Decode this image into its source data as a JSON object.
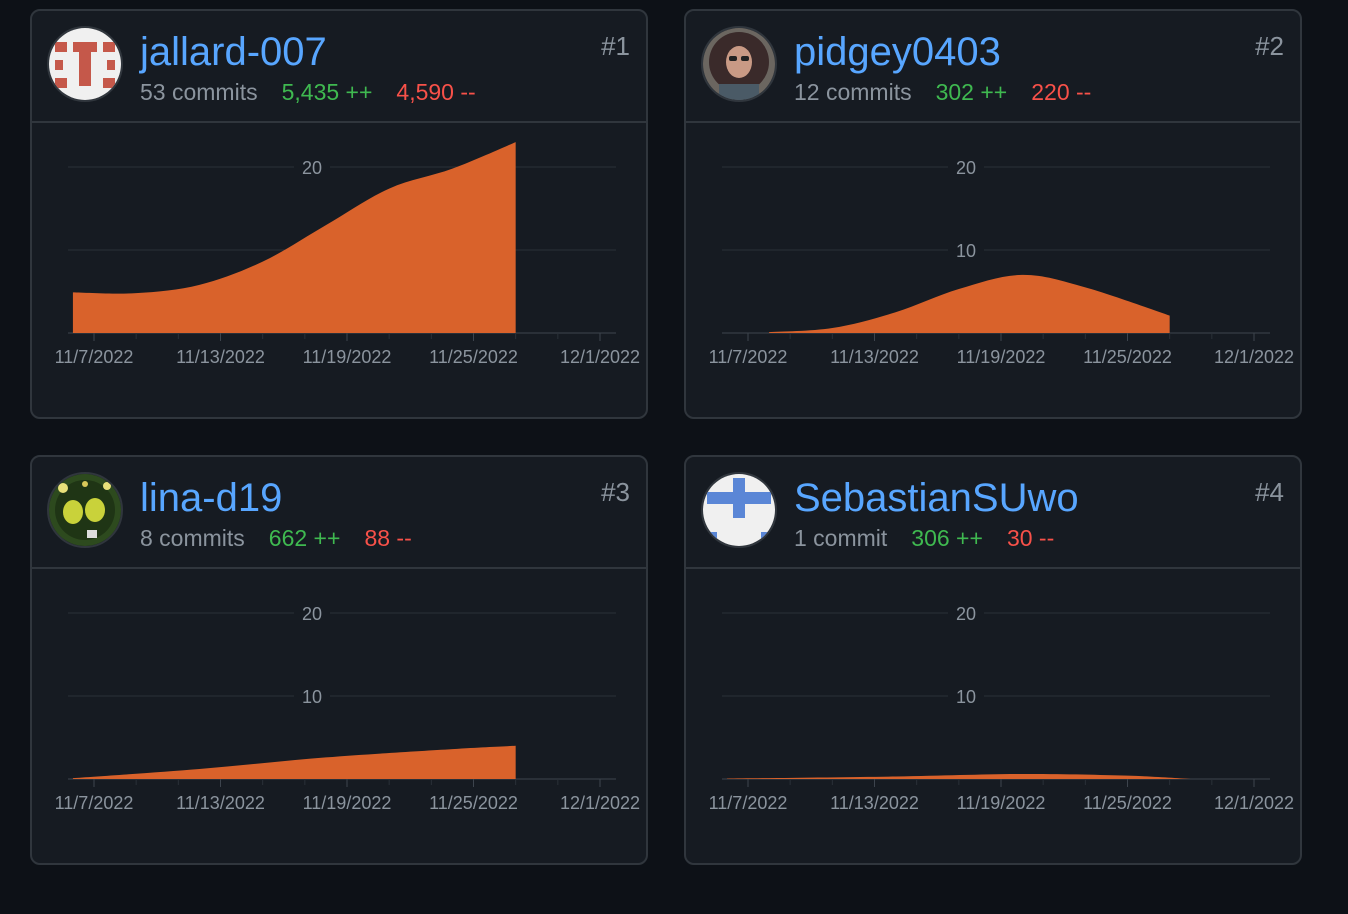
{
  "colors": {
    "background": "#0d1117",
    "card": "#161b22",
    "border": "#30363d",
    "link": "#58a6ff",
    "additions": "#3fb950",
    "deletions": "#f85149",
    "area": "#d9622b",
    "muted": "#8b949e"
  },
  "contributors": [
    {
      "username": "jallard-007",
      "commits": "53 commits",
      "additions": "5,435 ++",
      "deletions": "4,590 --",
      "rank": "#1",
      "avatar_icon": "identicon-red-icon"
    },
    {
      "username": "pidgey0403",
      "commits": "12 commits",
      "additions": "302 ++",
      "deletions": "220 --",
      "rank": "#2",
      "avatar_icon": "profile-photo-icon"
    },
    {
      "username": "lina-d19",
      "commits": "8 commits",
      "additions": "662 ++",
      "deletions": "88 --",
      "rank": "#3",
      "avatar_icon": "frogs-photo-icon"
    },
    {
      "username": "SebastianSUwo",
      "commits": "1 commit",
      "additions": "306 ++",
      "deletions": "30 --",
      "rank": "#4",
      "avatar_icon": "identicon-blue-icon"
    }
  ],
  "chart_data": [
    {
      "type": "area",
      "x_ticks": [
        "11/7/2022",
        "11/13/2022",
        "11/19/2022",
        "11/25/2022",
        "12/1/2022"
      ],
      "y_ticks": [
        "20"
      ],
      "ylim": [
        0,
        20
      ],
      "x": [
        "11/6/2022",
        "11/9/2022",
        "11/12/2022",
        "11/15/2022",
        "11/18/2022",
        "11/21/2022",
        "11/24/2022",
        "11/27/2022"
      ],
      "values": [
        4.9,
        4.8,
        5.8,
        8.6,
        13.0,
        17.4,
        19.8,
        23.0
      ]
    },
    {
      "type": "area",
      "x_ticks": [
        "11/7/2022",
        "11/13/2022",
        "11/19/2022",
        "11/25/2022",
        "12/1/2022"
      ],
      "y_ticks": [
        "20",
        "10"
      ],
      "ylim": [
        0,
        20
      ],
      "x": [
        "11/8/2022",
        "11/11/2022",
        "11/14/2022",
        "11/17/2022",
        "11/20/2022",
        "11/23/2022",
        "11/27/2022"
      ],
      "values": [
        0.1,
        0.6,
        2.5,
        5.3,
        7.0,
        5.5,
        2.1
      ]
    },
    {
      "type": "area",
      "x_ticks": [
        "11/7/2022",
        "11/13/2022",
        "11/19/2022",
        "11/25/2022",
        "12/1/2022"
      ],
      "y_ticks": [
        "20",
        "10"
      ],
      "ylim": [
        0,
        20
      ],
      "x": [
        "11/6/2022",
        "11/12/2022",
        "11/18/2022",
        "11/24/2022",
        "11/27/2022"
      ],
      "values": [
        0.1,
        1.2,
        2.6,
        3.6,
        4.0
      ]
    },
    {
      "type": "area",
      "x_ticks": [
        "11/7/2022",
        "11/13/2022",
        "11/19/2022",
        "11/25/2022",
        "12/1/2022"
      ],
      "y_ticks": [
        "20",
        "10"
      ],
      "ylim": [
        0,
        20
      ],
      "x": [
        "11/6/2022",
        "11/14/2022",
        "11/20/2022",
        "11/25/2022",
        "11/28/2022"
      ],
      "values": [
        0.05,
        0.3,
        0.6,
        0.4,
        0.0
      ]
    }
  ]
}
